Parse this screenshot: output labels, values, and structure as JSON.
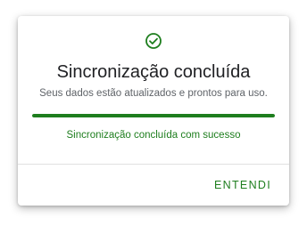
{
  "dialog": {
    "icon": "check-circle-icon",
    "title": "Sincronização concluída",
    "subtitle": "Seus dados estão atualizados e prontos para uso.",
    "progress": 1.0,
    "status": "Sincronização concluída com sucesso",
    "ok_label": "ENTENDI"
  },
  "colors": {
    "accent": "#1e7e1e",
    "title": "#202124",
    "subtitle": "#5f6368",
    "divider": "#e0e0e0"
  }
}
